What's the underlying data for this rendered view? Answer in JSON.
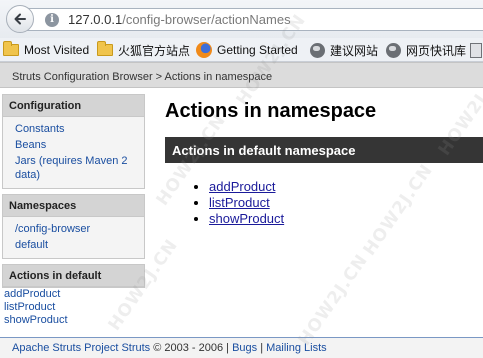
{
  "browser": {
    "url_host": "127.0.0.1",
    "url_path": "/config-browser/actionNames",
    "bookmarks": [
      {
        "label": "Most Visited",
        "icon": "folder-icon"
      },
      {
        "label": "火狐官方站点",
        "icon": "folder-icon"
      },
      {
        "label": "Getting Started",
        "icon": "firefox-icon"
      },
      {
        "label": "建议网站",
        "icon": "globe-icon"
      },
      {
        "label": "网页快讯库",
        "icon": "globe-icon"
      },
      {
        "label": "",
        "icon": "page-icon"
      }
    ]
  },
  "page": {
    "breadcrumb": "Struts Configuration Browser > Actions in namespace",
    "title": "Actions in namespace",
    "section_title": "Actions in default namespace",
    "actions": [
      "addProduct",
      "listProduct",
      "showProduct"
    ]
  },
  "sidebar": {
    "configuration": {
      "title": "Configuration",
      "links": [
        "Constants",
        "Beans",
        "Jars (requires Maven 2 data)"
      ]
    },
    "namespaces": {
      "title": "Namespaces",
      "links": [
        "/config-browser",
        "default"
      ]
    },
    "actions": {
      "title": "Actions in default",
      "links": [
        "addProduct",
        "listProduct",
        "showProduct"
      ]
    }
  },
  "footer": {
    "project": "Apache Struts Project Struts",
    "copyright": " © 2003 - 2006 | ",
    "bugs": "Bugs",
    "sep": " | ",
    "mailing": "Mailing Lists"
  },
  "watermark": "HOW2J.CN",
  "colors": {
    "link": "#1a4ea0",
    "section_bar": "#353535",
    "sidebar_header": "#d4d4d4"
  }
}
